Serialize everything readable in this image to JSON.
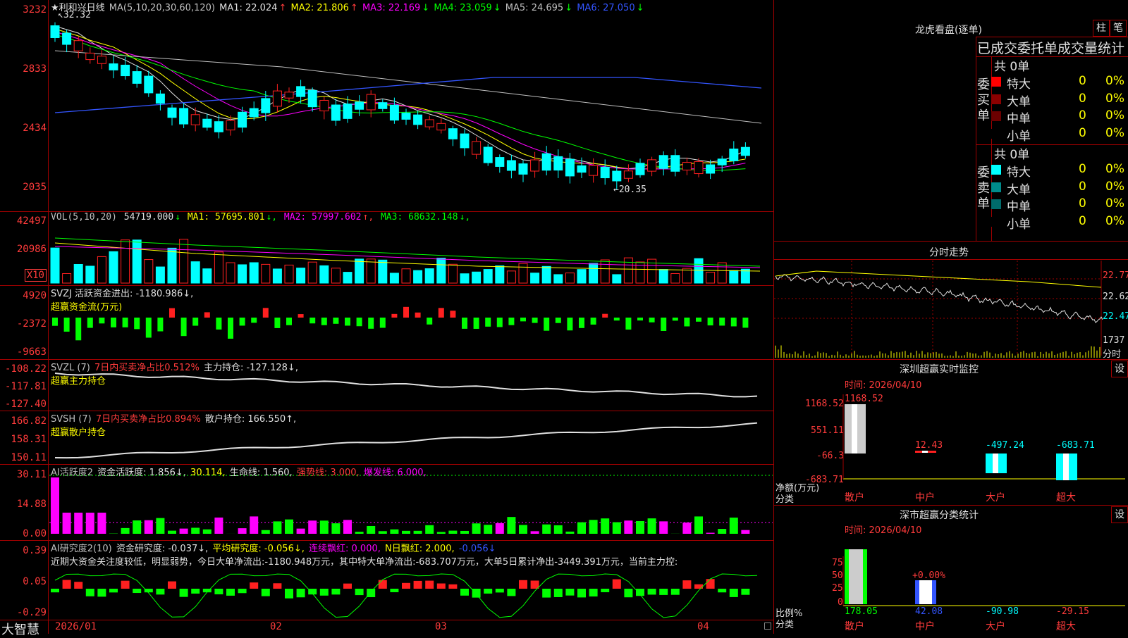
{
  "main": {
    "stock_name": "★利和兴日线",
    "ma_label": "MA(5,10,20,30,60,120)",
    "ma": [
      {
        "label": "MA1:",
        "value": "22.024",
        "arrow": "↑",
        "color": "#e0e0e0"
      },
      {
        "label": "MA2:",
        "value": "21.806",
        "arrow": "↑",
        "color": "#ffff00"
      },
      {
        "label": "MA3:",
        "value": "22.169",
        "arrow": "↓",
        "color": "#ff00ff"
      },
      {
        "label": "MA4:",
        "value": "23.059",
        "arrow": "↓",
        "color": "#00ff00"
      },
      {
        "label": "MA5:",
        "value": "24.695",
        "arrow": "↓",
        "color": "#c0c0c0"
      },
      {
        "label": "MA6:",
        "value": "27.050",
        "arrow": "↓",
        "color": "#3355ff"
      }
    ],
    "yticks": [
      "3232",
      "2833",
      "2434",
      "2035"
    ],
    "high_label": "32.32",
    "low_label": "20.35"
  },
  "vol": {
    "label": "VOL(5,10,20)",
    "value": "54719.000",
    "value_arrow": "↓",
    "ma": [
      {
        "label": "MA1:",
        "value": "57695.801",
        "arrow": "↓",
        "color": "#ffff00"
      },
      {
        "label": "MA2:",
        "value": "57997.602",
        "arrow": "↑",
        "color": "#ff00ff"
      },
      {
        "label": "MA3:",
        "value": "68632.148",
        "arrow": "↓",
        "color": "#00ff00"
      }
    ],
    "yticks": [
      "42497",
      "20986"
    ],
    "unit": "X10"
  },
  "svzj": {
    "line1": "SVZJ  活跃资金进出: -1180.986↓,",
    "line2": "超赢资金流(万元)",
    "yticks": [
      "4920",
      "-2372",
      "-9663"
    ]
  },
  "svzl": {
    "prefix": "SVZL (7)",
    "desc": "7日内买卖净占比0.512%",
    "rest": "主力持仓: -127.128↓,",
    "line2": "超赢主力持仓",
    "yticks": [
      "-108.22",
      "-117.81",
      "-127.40"
    ]
  },
  "svsh": {
    "prefix": "SVSH (7)",
    "desc": "7日内买卖净占比0.894%",
    "rest": "散户持仓: 166.550↑,",
    "line2": "超赢散户持仓",
    "yticks": [
      "166.82",
      "158.31",
      "150.11"
    ]
  },
  "ai1": {
    "prefix": "AI活跃度2",
    "a": "资金活跃度: 1.856↓,",
    "b": "30.114,",
    "c": "生命线: 1.560,",
    "d": "强势线: 3.000,",
    "e": "爆发线: 6.000,",
    "yticks": [
      "30.11",
      "14.88",
      "0.00"
    ]
  },
  "ai2": {
    "prefix": "AI研究度2(10)",
    "a": "资金研究度: -0.037↓,",
    "b": "平均研究度: -0.056↓,",
    "c": "连续飘红: 0.000,",
    "d": "N日飘红: 2.000,",
    "e": "-0.056↓",
    "comment": "近期大资金关注度较低，明显弱势，今日大单净流出:-1180.948万元，其中特大单净流出:-683.707万元，大单5日累计净出-3449.391万元，当前主力控:",
    "yticks": [
      "0.39",
      "0.05",
      "-0.29"
    ]
  },
  "xaxis": {
    "brand": "大智慧",
    "ticks": [
      "2026/01",
      "02",
      "03",
      "04"
    ]
  },
  "right": {
    "longhu": {
      "title": "龙虎看盘(逐单)",
      "btn1": "柱",
      "btn2": "笔",
      "subtitle": "已成交委托单成交量统计",
      "buy_label": "委买单",
      "sell_label": "委卖单",
      "buy_total": "共 0单",
      "sell_total": "共 0单",
      "buy_rows": [
        {
          "name": "特大",
          "vol": "0",
          "pct": "0%",
          "color": "#ff0000"
        },
        {
          "name": "大单",
          "vol": "0",
          "pct": "0%",
          "color": "#8b0000"
        },
        {
          "name": "中单",
          "vol": "0",
          "pct": "0%",
          "color": "#6b0000"
        },
        {
          "name": "小单",
          "vol": "0",
          "pct": "0%",
          "color": "#000000"
        }
      ],
      "sell_rows": [
        {
          "name": "特大",
          "vol": "0",
          "pct": "0%",
          "color": "#00ffff"
        },
        {
          "name": "大单",
          "vol": "0",
          "pct": "0%",
          "color": "#008b8b"
        },
        {
          "name": "中单",
          "vol": "0",
          "pct": "0%",
          "color": "#006b6b"
        },
        {
          "name": "小单",
          "vol": "0",
          "pct": "0%",
          "color": "#000000"
        }
      ]
    },
    "intraday": {
      "title": "分时走势",
      "yticks": [
        "22.77",
        "22.62",
        "22.47"
      ],
      "vol_tick": "1737",
      "vol_unit": "分时"
    },
    "monitor": {
      "title": "深圳超赢实时监控",
      "btn": "设",
      "time": "时间: 2026/04/10",
      "yticks": [
        "1168.52",
        "551.11",
        "-66.3",
        "-683.71"
      ],
      "ylabel": "净额(万元)",
      "xlabel": "分类",
      "bars": [
        {
          "name": "散户",
          "value": "1168.52"
        },
        {
          "name": "中户",
          "value": "12.43"
        },
        {
          "name": "大户",
          "value": "-497.24"
        },
        {
          "name": "超大",
          "value": "-683.71"
        }
      ]
    },
    "classify": {
      "title": "深市超赢分类统计",
      "btn": "设",
      "time": "时间: 2026/04/10",
      "yticks": [
        "75",
        "50",
        "25",
        "0"
      ],
      "ylabel": "比例%",
      "xlabel": "分类",
      "mid_label": "+0.00%",
      "bars": [
        {
          "name": "散户",
          "value": "178.05"
        },
        {
          "name": "中户",
          "value": "42.08"
        },
        {
          "name": "大户",
          "value": "-90.98"
        },
        {
          "name": "超大",
          "value": "-29.15"
        }
      ]
    }
  }
}
